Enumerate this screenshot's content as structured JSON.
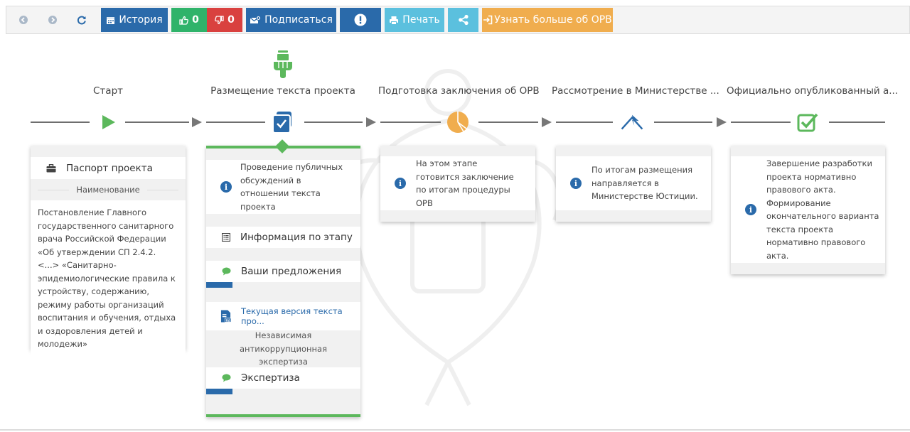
{
  "toolbar": {
    "history_label": "История",
    "likes": "0",
    "dislikes": "0",
    "subscribe_label": "Подписаться",
    "print_label": "Печать",
    "more_label": "Узнать больше об ОРВ"
  },
  "steps": [
    {
      "title": "Старт",
      "icon": "play-icon"
    },
    {
      "title": "Размещение текста проекта",
      "icon": "checkbox-icon"
    },
    {
      "title": "Подготовка заключения об ОРВ",
      "icon": "pie-chart-icon"
    },
    {
      "title": "Рассмотрение в Министерстве ...",
      "icon": "arrow-up-icon"
    },
    {
      "title": "Официально опубликованный а...",
      "icon": "check-square-icon"
    }
  ],
  "card1": {
    "passport_label": "Паспорт проекта",
    "name_label": "Наименование",
    "name_text": "Постановление Главного государственного санитарного врача Российской Федерации «Об утверждении СП 2.4.2. <...> «Санитарно-эпидемиологические правила к устройству, содержанию, режиму работы организаций воспитания и обучения, отдыха и оздоровления детей и молодежи»"
  },
  "card2": {
    "info_text": "Проведение публичных обсуждений в отношении текста проекта",
    "stage_info_label": "Информация по этапу",
    "proposals_label": "Ваши предложения",
    "proposals_progress": 0.17,
    "current_version_label": "Текущая версия текста про...",
    "expertise_title": "Независимая антикоррупционная экспертиза",
    "expertise_label": "Экспертиза",
    "expertise_progress": 0.17
  },
  "card3": {
    "info_text": "На этом этапе готовится заключение по итогам процедуры ОРВ"
  },
  "card4": {
    "info_text": "По итогам размещения направляется в Министерстве Юстиции."
  },
  "card5": {
    "info_text": "Завершение разработки проекта нормативно правового акта. Формирование окончательного варианта текста проекта нормативно правового акта."
  },
  "colors": {
    "primary": "#2a6aaa",
    "green": "#5cb85c",
    "orange": "#f0ad4e",
    "red": "#d9413f",
    "info": "#5bc0de"
  }
}
